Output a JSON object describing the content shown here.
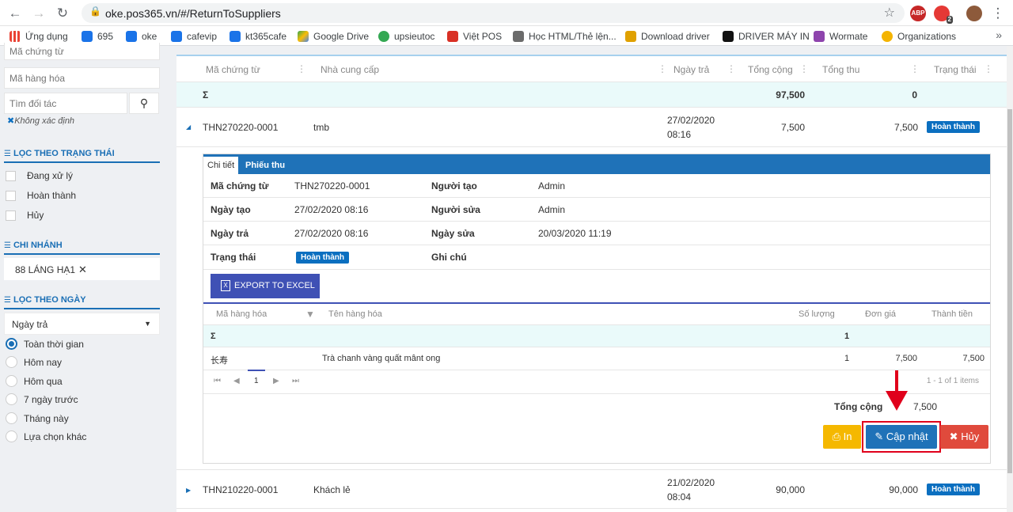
{
  "browser": {
    "url": "oke.pos365.vn/#/ReturnToSuppliers",
    "ext_abp": "ABP",
    "ext_badge": "2",
    "bookmarks": [
      {
        "label": "Ứng dụng",
        "color": "#ea4335"
      },
      {
        "label": "695",
        "color": "#1a73e8"
      },
      {
        "label": "oke",
        "color": "#1a73e8"
      },
      {
        "label": "cafevip",
        "color": "#1a73e8"
      },
      {
        "label": "kt365cafe",
        "color": "#1a73e8"
      },
      {
        "label": "Google Drive",
        "color": "#fbbc04"
      },
      {
        "label": "upsieutoc",
        "color": "#34a853"
      },
      {
        "label": "Việt POS",
        "color": "#d93025"
      },
      {
        "label": "Học HTML/Thẻ lện...",
        "color": "#6b6b6b"
      },
      {
        "label": "Download driver",
        "color": "#e0a100"
      },
      {
        "label": "DRIVER MÁY IN",
        "color": "#111111"
      },
      {
        "label": "Wormate",
        "color": "#8e44ad"
      },
      {
        "label": "Organizations",
        "color": "#f4b400"
      }
    ]
  },
  "sidebar": {
    "search_doc_placeholder": "Mã chứng từ",
    "search_item_placeholder": "Mã hàng hóa",
    "search_partner_placeholder": "Tìm đối tác",
    "undefined_label": "Không xác định",
    "status_title": "LỌC THEO TRẠNG THÁI",
    "status_items": [
      "Đang xử lý",
      "Hoàn thành",
      "Hủy"
    ],
    "branch_title": "CHI NHÁNH",
    "branch_value": "88 LÁNG HẠ1",
    "date_title": "LỌC THEO NGÀY",
    "date_field": "Ngày trả",
    "date_options": [
      "Toàn thời gian",
      "Hôm nay",
      "Hôm qua",
      "7 ngày trước",
      "Tháng này",
      "Lựa chọn khác"
    ]
  },
  "grid": {
    "columns": [
      "Mã chứng từ",
      "Nhà cung cấp",
      "Ngày trả",
      "Tổng cộng",
      "Tổng thu",
      "Trạng thái"
    ],
    "sum_symbol": "Σ",
    "sum_total": "97,500",
    "sum_paid": "0",
    "rows": [
      {
        "code": "THN270220-0001",
        "supplier": "tmb",
        "date": "27/02/2020",
        "time": "08:16",
        "total": "7,500",
        "paid": "7,500",
        "status": "Hoàn thành"
      },
      {
        "code": "THN210220-0001",
        "supplier": "Khách lẻ",
        "date": "21/02/2020",
        "time": "08:04",
        "total": "90,000",
        "paid": "90,000",
        "status": "Hoàn thành"
      }
    ]
  },
  "detail": {
    "tabs": [
      "Chi tiết",
      "Phiếu thu"
    ],
    "fields": {
      "code_label": "Mã chứng từ",
      "code": "THN270220-0001",
      "creator_label": "Người tạo",
      "creator": "Admin",
      "created_label": "Ngày tạo",
      "created": "27/02/2020 08:16",
      "editor_label": "Người sửa",
      "editor": "Admin",
      "return_label": "Ngày trả",
      "return_date": "27/02/2020 08:16",
      "edited_label": "Ngày sửa",
      "edited": "20/03/2020 11:19",
      "status_label": "Trạng thái",
      "status": "Hoàn thành",
      "note_label": "Ghi chú"
    },
    "export_label": "EXPORT TO EXCEL",
    "items_columns": [
      "Mã hàng hóa",
      "Tên hàng hóa",
      "Số lượng",
      "Đơn giá",
      "Thành tiền"
    ],
    "items_sum_symbol": "Σ",
    "items_sum_qty": "1",
    "items": [
      {
        "code": "长寿",
        "name": "Trà chanh vàng quất mânt ong",
        "qty": "1",
        "price": "7,500",
        "amount": "7,500"
      }
    ],
    "pager": {
      "page": "1",
      "info": "1 - 1 of 1 items"
    },
    "total_label": "Tổng cộng",
    "total_value": "7,500",
    "buttons": {
      "print": "In",
      "update": "Cập nhật",
      "cancel": "Hủy"
    }
  }
}
